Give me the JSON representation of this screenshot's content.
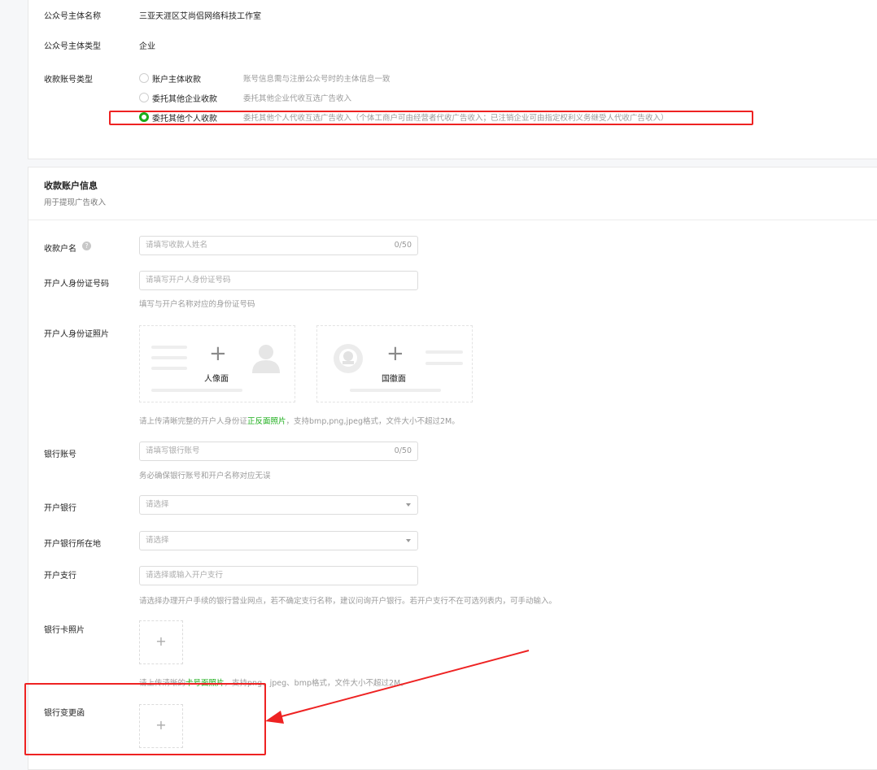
{
  "account_subject": {
    "name_label": "公众号主体名称",
    "name_value": "三亚天涯区艾尚侣网络科技工作室",
    "type_label": "公众号主体类型",
    "type_value": "企业",
    "receive_type_label": "收款账号类型",
    "options": [
      {
        "label": "账户主体收款",
        "desc": "账号信息需与注册公众号时的主体信息一致",
        "selected": false
      },
      {
        "label": "委托其他企业收款",
        "desc": "委托其他企业代收互选广告收入",
        "selected": false
      },
      {
        "label": "委托其他个人收款",
        "desc": "委托其他个人代收互选广告收入（个体工商户可由经营者代收广告收入；已注销企业可由指定权利义务继受人代收广告收入）",
        "selected": true
      }
    ]
  },
  "receive_info": {
    "title": "收款账户信息",
    "subtitle": "用于提现广告收入",
    "payee_name": {
      "label": "收款户名",
      "placeholder": "请填写收款人姓名",
      "count": "0/50"
    },
    "id_number": {
      "label": "开户人身份证号码",
      "placeholder": "请填写开户人身份证号码",
      "hint": "填写与开户名称对应的身份证号码"
    },
    "id_photo": {
      "label": "开户人身份证照片",
      "front_label": "人像面",
      "back_label": "国徽面",
      "hint_prefix": "请上传清晰完整的开户人身份证",
      "hint_link": "正反面照片",
      "hint_suffix": "，支持bmp,png,jpeg格式，文件大小不超过2M。"
    },
    "bank_account": {
      "label": "银行账号",
      "placeholder": "请填写银行账号",
      "count": "0/50",
      "hint": "务必确保银行账号和开户名称对应无误"
    },
    "bank": {
      "label": "开户银行",
      "placeholder": "请选择"
    },
    "bank_location": {
      "label": "开户银行所在地",
      "placeholder": "请选择"
    },
    "branch": {
      "label": "开户支行",
      "placeholder": "请选择或输入开户支行",
      "hint": "请选择办理开户手续的银行营业网点，若不确定支行名称，建议问询开户银行。若开户支行不在可选列表内，可手动输入。"
    },
    "card_photo": {
      "label": "银行卡照片",
      "hint_prefix": "请上传清晰的",
      "hint_link": "卡号面照片",
      "hint_suffix": "，支持png、jpeg、bmp格式，文件大小不超过2M。"
    },
    "change_letter": {
      "label": "银行变更函"
    }
  },
  "upload_plus": "+",
  "icons": [
    "plus-icon",
    "person-silhouette-icon",
    "national-emblem-icon",
    "help-icon",
    "dropdown-arrow-icon"
  ],
  "colors": {
    "accent": "#1aad19",
    "annotation": "#ee2222"
  }
}
